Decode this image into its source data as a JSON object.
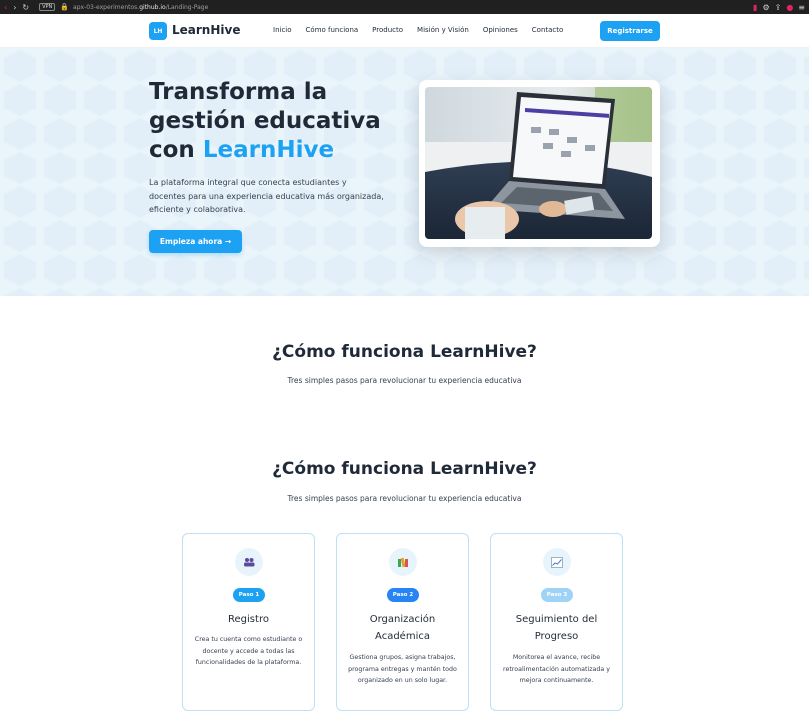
{
  "browser": {
    "vpn": "VPN",
    "url_prefix": "apx-03-experimentos.",
    "url_domain": "github.io",
    "url_path": "/Landing-Page"
  },
  "navbar": {
    "logo_badge": "LH",
    "logo_text": "LearnHive",
    "links": [
      "Inicio",
      "Cómo funciona",
      "Producto",
      "Misión y Visión",
      "Opiniones",
      "Contacto"
    ],
    "register": "Registrarse"
  },
  "hero": {
    "title_line1": "Transforma la",
    "title_line2": "gestión educativa",
    "title_line3_prefix": "con ",
    "title_accent": "LearnHive",
    "description": "La plataforma integral que conecta estudiantes y docentes para una experiencia educativa más organizada, eficiente y colaborativa.",
    "cta": "Empieza ahora →"
  },
  "section1": {
    "title": "¿Cómo funciona LearnHive?",
    "subtitle": "Tres simples pasos para revolucionar tu experiencia educativa"
  },
  "section2": {
    "title": "¿Cómo funciona LearnHive?",
    "subtitle": "Tres simples pasos para revolucionar tu experiencia educativa",
    "steps": [
      {
        "icon": "people-icon",
        "badge": "Paso 1",
        "badge_color": "#1da1f2",
        "title": "Registro",
        "description": "Crea tu cuenta como estudiante o docente y accede a todas las funcionalidades de la plataforma."
      },
      {
        "icon": "books-icon",
        "badge": "Paso 2",
        "badge_color": "#2684f5",
        "title": "Organización Académica",
        "description": "Gestiona grupos, asigna trabajos, programa entregas y mantén todo organizado en un solo lugar."
      },
      {
        "icon": "chart-icon",
        "badge": "Paso 3",
        "badge_color": "#9fd3f5",
        "title": "Seguimiento del Progreso",
        "description": "Monitorea el avance, recibe retroalimentación automatizada y mejora continuamente."
      }
    ]
  },
  "colors": {
    "accent": "#1da1f2",
    "hero_bg": "#eaf4fb",
    "card_border": "#bfe0f5"
  }
}
